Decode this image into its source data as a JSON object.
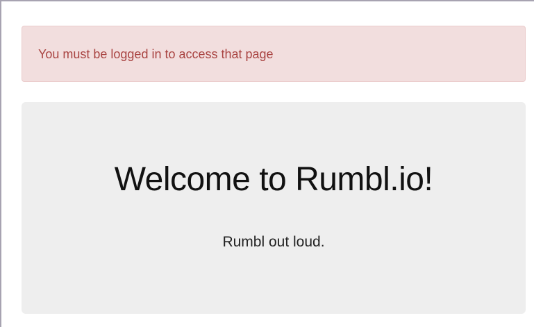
{
  "alert": {
    "message": "You must be logged in to access that page"
  },
  "jumbotron": {
    "title": "Welcome to Rumbl.io!",
    "tagline": "Rumbl out loud."
  },
  "colors": {
    "alert_background": "#f2dede",
    "alert_border": "#ebcccc",
    "alert_text": "#a94442",
    "jumbotron_background": "#eeeeee"
  }
}
